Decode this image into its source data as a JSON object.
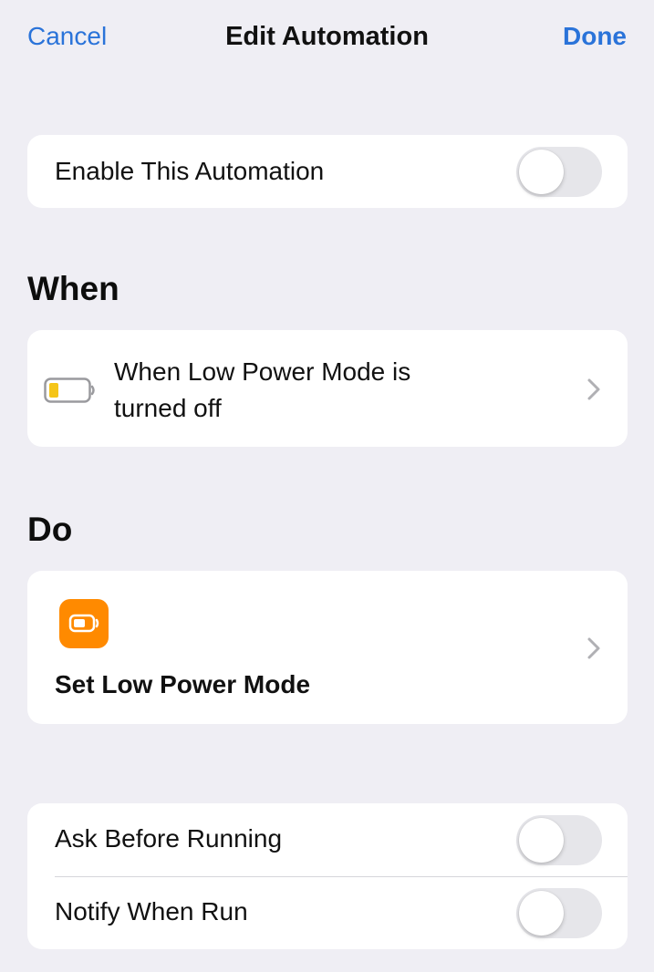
{
  "nav": {
    "cancel_label": "Cancel",
    "title": "Edit Automation",
    "done_label": "Done"
  },
  "enable_row": {
    "label": "Enable This Automation",
    "toggle_on": false
  },
  "when_section": {
    "heading": "When",
    "trigger_line1": "When Low Power Mode is",
    "trigger_line2": "turned off",
    "icon": "battery-low-icon"
  },
  "do_section": {
    "heading": "Do",
    "action_label": "Set Low Power Mode",
    "icon": "battery-icon"
  },
  "options": {
    "ask_label": "Ask Before Running",
    "ask_on": false,
    "notify_label": "Notify When Run",
    "notify_on": false
  },
  "colors": {
    "accent": "#2a73d9",
    "background": "#efeef4",
    "action_icon_bg": "#ff8a00",
    "battery_fill": "#f5c518"
  }
}
